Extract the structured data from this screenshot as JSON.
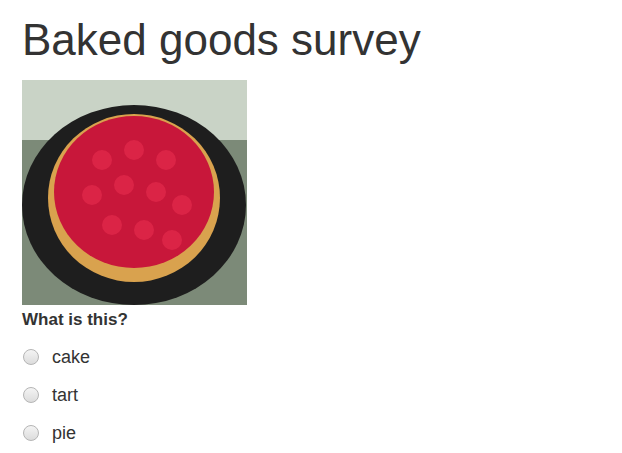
{
  "title": "Baked goods survey",
  "photo": {
    "alt": "tart"
  },
  "question": {
    "text": "What is this?",
    "options": [
      {
        "label": "cake",
        "selected": false
      },
      {
        "label": "tart",
        "selected": false
      },
      {
        "label": "pie",
        "selected": false
      }
    ]
  }
}
